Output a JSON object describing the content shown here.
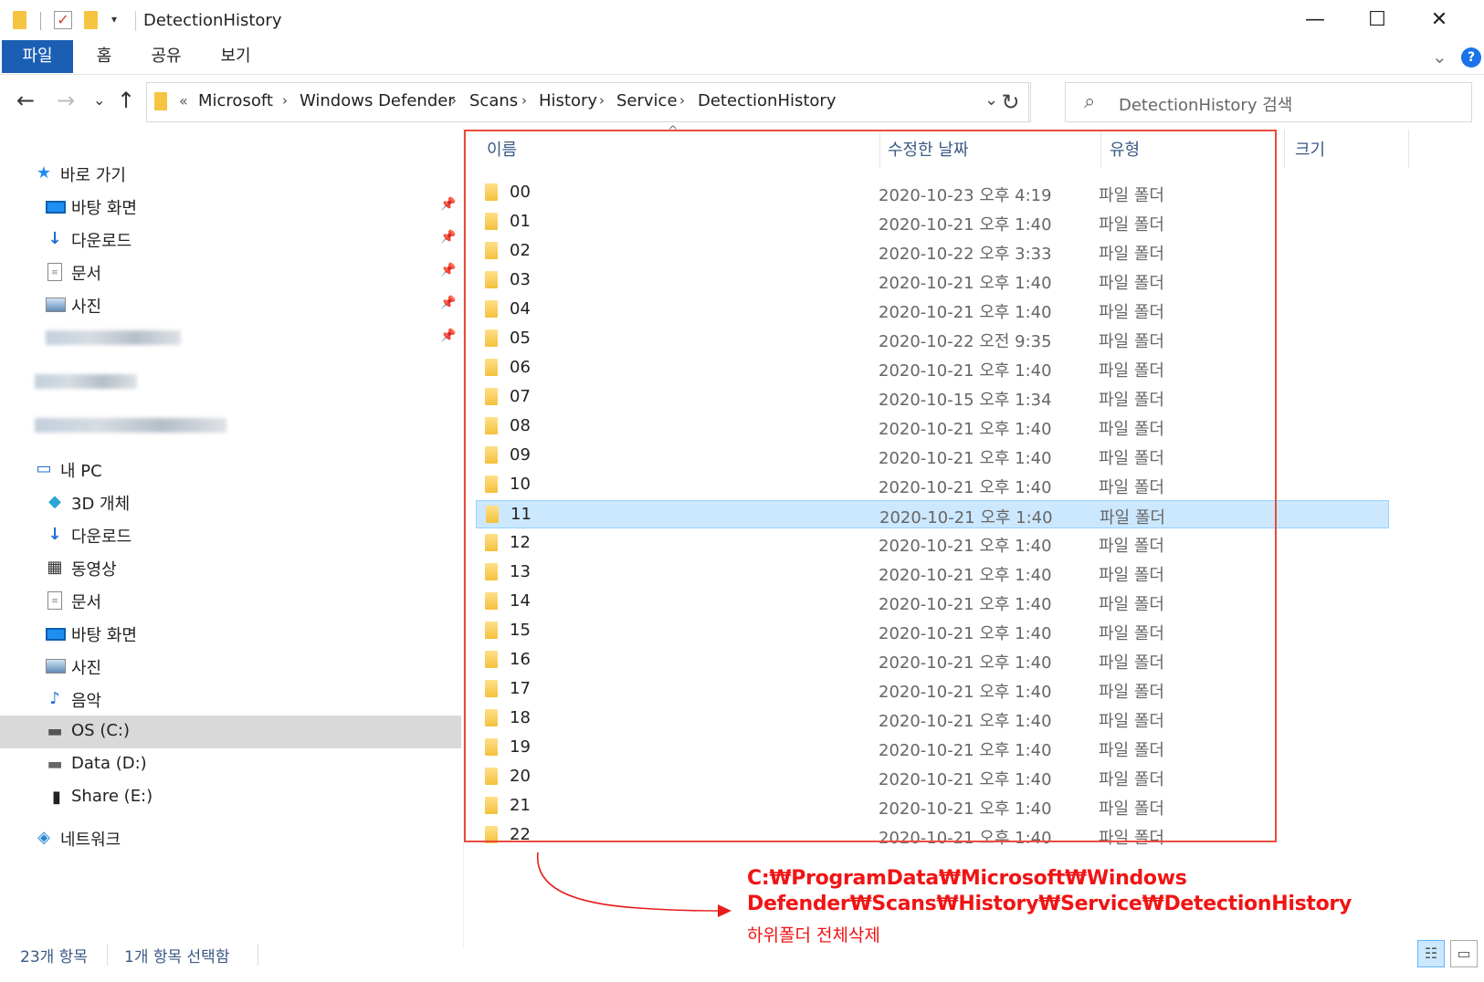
{
  "window": {
    "title": "DetectionHistory",
    "minimize": "—",
    "maximize": "☐",
    "close": "✕"
  },
  "ribbon": {
    "tabs": [
      "파일",
      "홈",
      "공유",
      "보기"
    ],
    "expand_chevron": "⌄",
    "help": "?"
  },
  "nav": {
    "back": "←",
    "forward": "→",
    "recent": "⌄",
    "up": "↑"
  },
  "address": {
    "overflow": "«",
    "crumbs": [
      "Microsoft",
      "Windows Defender",
      "Scans",
      "History",
      "Service",
      "DetectionHistory"
    ],
    "separator": "›",
    "dropdown": "⌄",
    "refresh": "↻"
  },
  "search": {
    "placeholder": "DetectionHistory 검색",
    "icon": "search-icon"
  },
  "sidebar": {
    "quick_access": "바로 가기",
    "quick_items": [
      "바탕 화면",
      "다운로드",
      "문서",
      "사진"
    ],
    "pin": "📌",
    "this_pc": "내 PC",
    "pc_items": [
      "3D 개체",
      "다운로드",
      "동영상",
      "문서",
      "바탕 화면",
      "사진",
      "음악",
      "OS (C:)",
      "Data (D:)",
      "Share (E:)"
    ],
    "network": "네트워크",
    "selected": "OS (C:)"
  },
  "columns": {
    "name": "이름",
    "date": "수정한 날짜",
    "type": "유형",
    "size": "크기",
    "sort_caret": "^"
  },
  "files": [
    {
      "name": "00",
      "date": "2020-10-23 오후 4:19",
      "type": "파일 폴더"
    },
    {
      "name": "01",
      "date": "2020-10-21 오후 1:40",
      "type": "파일 폴더"
    },
    {
      "name": "02",
      "date": "2020-10-22 오후 3:33",
      "type": "파일 폴더"
    },
    {
      "name": "03",
      "date": "2020-10-21 오후 1:40",
      "type": "파일 폴더"
    },
    {
      "name": "04",
      "date": "2020-10-21 오후 1:40",
      "type": "파일 폴더"
    },
    {
      "name": "05",
      "date": "2020-10-22 오전 9:35",
      "type": "파일 폴더"
    },
    {
      "name": "06",
      "date": "2020-10-21 오후 1:40",
      "type": "파일 폴더"
    },
    {
      "name": "07",
      "date": "2020-10-15 오후 1:34",
      "type": "파일 폴더"
    },
    {
      "name": "08",
      "date": "2020-10-21 오후 1:40",
      "type": "파일 폴더"
    },
    {
      "name": "09",
      "date": "2020-10-21 오후 1:40",
      "type": "파일 폴더"
    },
    {
      "name": "10",
      "date": "2020-10-21 오후 1:40",
      "type": "파일 폴더"
    },
    {
      "name": "11",
      "date": "2020-10-21 오후 1:40",
      "type": "파일 폴더"
    },
    {
      "name": "12",
      "date": "2020-10-21 오후 1:40",
      "type": "파일 폴더"
    },
    {
      "name": "13",
      "date": "2020-10-21 오후 1:40",
      "type": "파일 폴더"
    },
    {
      "name": "14",
      "date": "2020-10-21 오후 1:40",
      "type": "파일 폴더"
    },
    {
      "name": "15",
      "date": "2020-10-21 오후 1:40",
      "type": "파일 폴더"
    },
    {
      "name": "16",
      "date": "2020-10-21 오후 1:40",
      "type": "파일 폴더"
    },
    {
      "name": "17",
      "date": "2020-10-21 오후 1:40",
      "type": "파일 폴더"
    },
    {
      "name": "18",
      "date": "2020-10-21 오후 1:40",
      "type": "파일 폴더"
    },
    {
      "name": "19",
      "date": "2020-10-21 오후 1:40",
      "type": "파일 폴더"
    },
    {
      "name": "20",
      "date": "2020-10-21 오후 1:40",
      "type": "파일 폴더"
    },
    {
      "name": "21",
      "date": "2020-10-21 오후 1:40",
      "type": "파일 폴더"
    },
    {
      "name": "22",
      "date": "2020-10-21 오후 1:40",
      "type": "파일 폴더"
    }
  ],
  "selected_file": "11",
  "annotation": {
    "line1": "C:₩ProgramData₩Microsoft₩Windows",
    "line2": "Defender₩Scans₩History₩Service₩DetectionHistory",
    "line3": "하위폴더 전체삭제",
    "color": "#f01414"
  },
  "status": {
    "count": "23개 항목",
    "selected": "1개 항목 선택함",
    "view_details": "☷",
    "view_large": "▭"
  },
  "colors": {
    "accent": "#1a5fb4",
    "selection": "#cce8ff",
    "highlight_box": "#e84c3d"
  }
}
